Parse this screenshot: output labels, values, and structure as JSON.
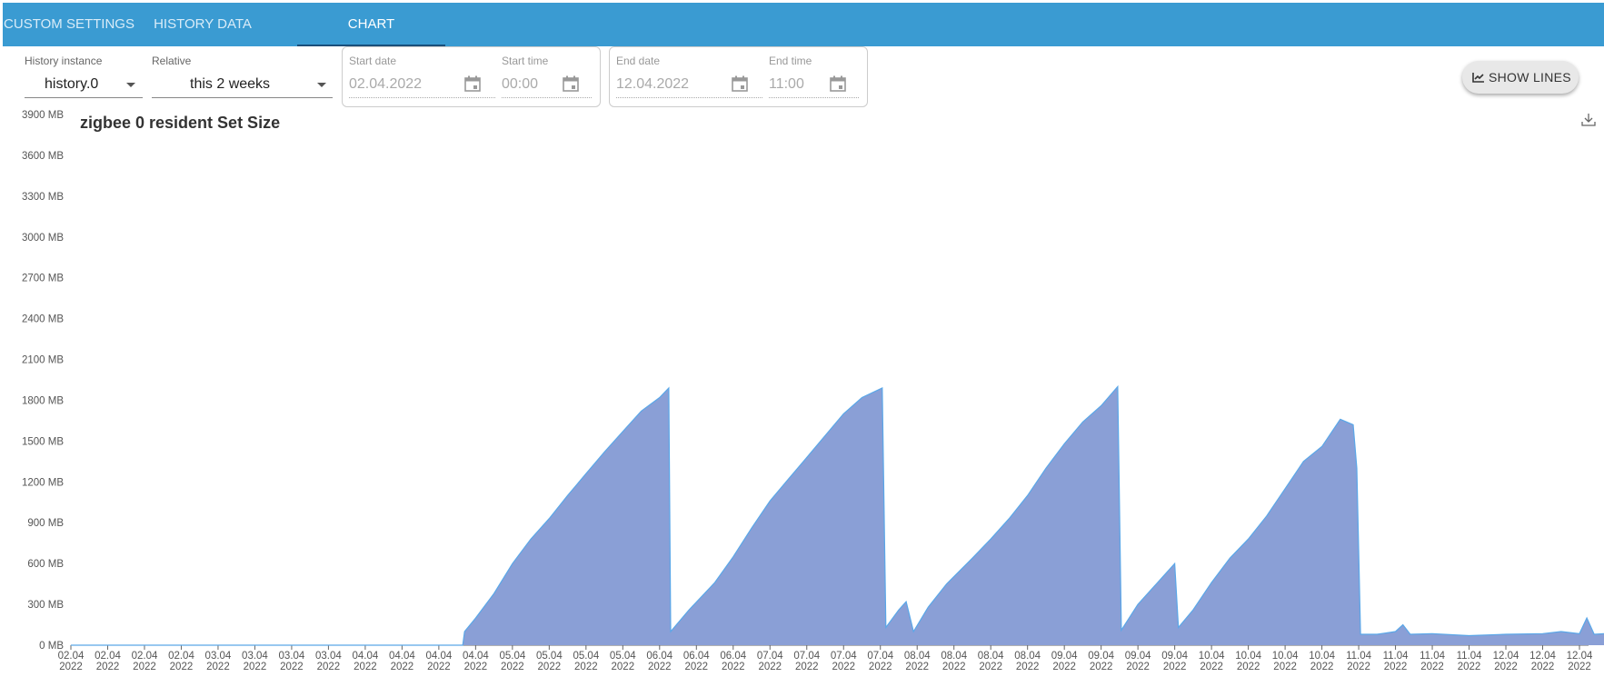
{
  "tabs": [
    {
      "label": "CUSTOM SETTINGS",
      "active": false
    },
    {
      "label": "HISTORY DATA",
      "active": false
    },
    {
      "label": "CHART",
      "active": true
    }
  ],
  "controls": {
    "history_instance": {
      "label": "History instance",
      "value": "history.0"
    },
    "relative": {
      "label": "Relative",
      "value": "this 2 weeks"
    },
    "start_date": {
      "label": "Start date",
      "value": "02.04.2022"
    },
    "start_time": {
      "label": "Start time",
      "value": "00:00"
    },
    "end_date": {
      "label": "End date",
      "value": "12.04.2022"
    },
    "end_time": {
      "label": "End time",
      "value": "11:00"
    },
    "show_lines_label": "SHOW LINES"
  },
  "colors": {
    "tabbar": "#3a9bd2",
    "area_fill": "#8a9fd6",
    "area_stroke": "#5aa7e8"
  },
  "icons": [
    "dropdown-caret-icon",
    "calendar-icon",
    "chart-line-icon",
    "download-icon"
  ],
  "chart_data": {
    "type": "area",
    "title": "zigbee 0 resident Set Size",
    "ylim": [
      0,
      3900
    ],
    "yticks": [
      "0 MB",
      "300 MB",
      "600 MB",
      "900 MB",
      "1200 MB",
      "1500 MB",
      "1800 MB",
      "2100 MB",
      "2400 MB",
      "2700 MB",
      "3000 MB",
      "3300 MB",
      "3600 MB",
      "3900 MB"
    ],
    "xticks": [
      [
        "02.04",
        "2022"
      ],
      [
        "02.04",
        "2022"
      ],
      [
        "02.04",
        "2022"
      ],
      [
        "02.04",
        "2022"
      ],
      [
        "03.04",
        "2022"
      ],
      [
        "03.04",
        "2022"
      ],
      [
        "03.04",
        "2022"
      ],
      [
        "03.04",
        "2022"
      ],
      [
        "04.04",
        "2022"
      ],
      [
        "04.04",
        "2022"
      ],
      [
        "04.04",
        "2022"
      ],
      [
        "04.04",
        "2022"
      ],
      [
        "05.04",
        "2022"
      ],
      [
        "05.04",
        "2022"
      ],
      [
        "05.04",
        "2022"
      ],
      [
        "05.04",
        "2022"
      ],
      [
        "06.04",
        "2022"
      ],
      [
        "06.04",
        "2022"
      ],
      [
        "06.04",
        "2022"
      ],
      [
        "07.04",
        "2022"
      ],
      [
        "07.04",
        "2022"
      ],
      [
        "07.04",
        "2022"
      ],
      [
        "07.04",
        "2022"
      ],
      [
        "08.04",
        "2022"
      ],
      [
        "08.04",
        "2022"
      ],
      [
        "08.04",
        "2022"
      ],
      [
        "08.04",
        "2022"
      ],
      [
        "09.04",
        "2022"
      ],
      [
        "09.04",
        "2022"
      ],
      [
        "09.04",
        "2022"
      ],
      [
        "09.04",
        "2022"
      ],
      [
        "10.04",
        "2022"
      ],
      [
        "10.04",
        "2022"
      ],
      [
        "10.04",
        "2022"
      ],
      [
        "10.04",
        "2022"
      ],
      [
        "11.04",
        "2022"
      ],
      [
        "11.04",
        "2022"
      ],
      [
        "11.04",
        "2022"
      ],
      [
        "11.04",
        "2022"
      ],
      [
        "12.04",
        "2022"
      ],
      [
        "12.04",
        "2022"
      ],
      [
        "12.04",
        "2022"
      ]
    ],
    "grid": false,
    "legend": "none",
    "series": [
      {
        "values": [
          [
            0,
            0
          ],
          [
            10.65,
            0
          ],
          [
            10.7,
            100
          ],
          [
            11.0,
            200
          ],
          [
            11.5,
            380
          ],
          [
            12.0,
            600
          ],
          [
            12.5,
            780
          ],
          [
            13.0,
            930
          ],
          [
            13.5,
            1100
          ],
          [
            14.0,
            1260
          ],
          [
            14.5,
            1420
          ],
          [
            15.0,
            1570
          ],
          [
            15.5,
            1720
          ],
          [
            16.0,
            1820
          ],
          [
            16.25,
            1890
          ],
          [
            16.3,
            100
          ],
          [
            16.8,
            260
          ],
          [
            17.5,
            460
          ],
          [
            18.0,
            650
          ],
          [
            18.5,
            860
          ],
          [
            19.0,
            1060
          ],
          [
            19.5,
            1220
          ],
          [
            20.0,
            1380
          ],
          [
            20.5,
            1540
          ],
          [
            21.0,
            1700
          ],
          [
            21.5,
            1820
          ],
          [
            22.05,
            1890
          ],
          [
            22.15,
            130
          ],
          [
            22.5,
            260
          ],
          [
            22.7,
            320
          ],
          [
            22.9,
            100
          ],
          [
            23.3,
            280
          ],
          [
            23.8,
            450
          ],
          [
            24.5,
            640
          ],
          [
            25.0,
            780
          ],
          [
            25.5,
            930
          ],
          [
            26.0,
            1100
          ],
          [
            26.5,
            1300
          ],
          [
            27.0,
            1480
          ],
          [
            27.5,
            1640
          ],
          [
            28.0,
            1760
          ],
          [
            28.45,
            1900
          ],
          [
            28.55,
            110
          ],
          [
            29.0,
            300
          ],
          [
            29.5,
            450
          ],
          [
            30.0,
            600
          ],
          [
            30.1,
            130
          ],
          [
            30.5,
            260
          ],
          [
            31.0,
            460
          ],
          [
            31.5,
            640
          ],
          [
            32.0,
            780
          ],
          [
            32.5,
            950
          ],
          [
            33.0,
            1150
          ],
          [
            33.5,
            1350
          ],
          [
            34.0,
            1460
          ],
          [
            34.5,
            1660
          ],
          [
            34.85,
            1620
          ],
          [
            34.95,
            1300
          ],
          [
            35.05,
            80
          ],
          [
            35.5,
            80
          ],
          [
            36.0,
            100
          ],
          [
            36.2,
            150
          ],
          [
            36.4,
            80
          ],
          [
            37.0,
            85
          ],
          [
            38.0,
            70
          ],
          [
            39.0,
            80
          ],
          [
            40.0,
            85
          ],
          [
            40.5,
            100
          ],
          [
            41.0,
            85
          ],
          [
            41.2,
            200
          ],
          [
            41.4,
            80
          ],
          [
            42.0,
            90
          ],
          [
            43.0,
            85
          ],
          [
            44.0,
            80
          ],
          [
            45.0,
            75
          ],
          [
            45.05,
            0
          ]
        ]
      }
    ]
  }
}
